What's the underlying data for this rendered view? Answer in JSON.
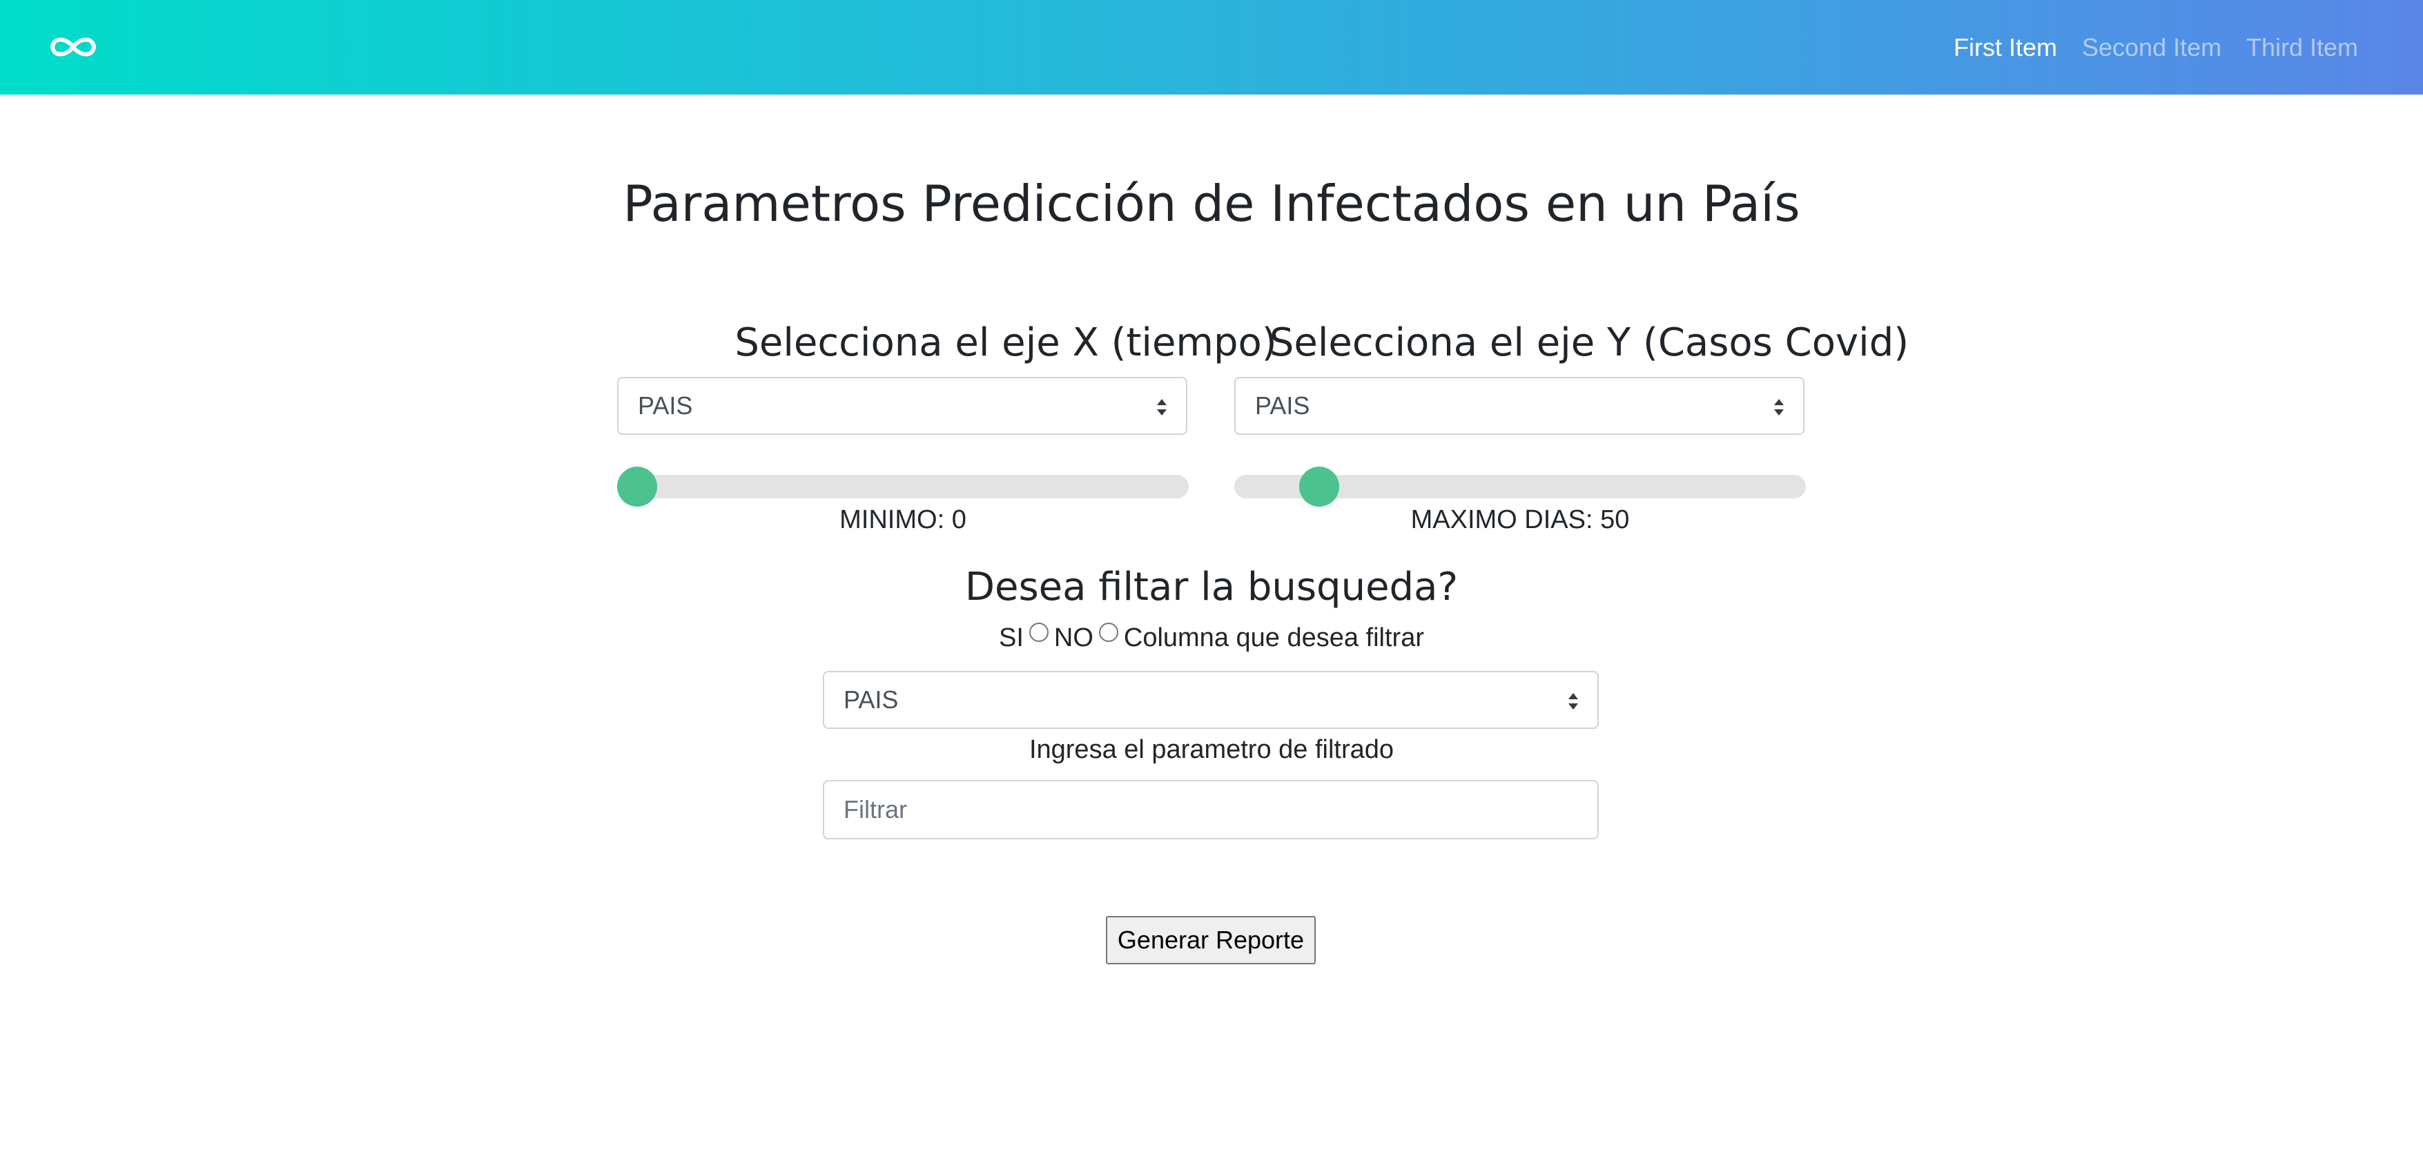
{
  "navbar": {
    "logo_icon": "infinity-icon",
    "items": [
      {
        "label": "First Item",
        "active": true
      },
      {
        "label": "Second Item",
        "active": false
      },
      {
        "label": "Third Item",
        "active": false
      }
    ],
    "gradient_colors": [
      "#00dcc9",
      "#5a86e8"
    ]
  },
  "page": {
    "title": "Parametros Predicción de Infectados en un País"
  },
  "axis_x": {
    "heading": "Selecciona el eje X (tiempo)",
    "select_value": "PAIS",
    "slider_value": 0,
    "caption": "MINIMO: 0"
  },
  "axis_y": {
    "heading": "Selecciona el eje Y (Casos Covid)",
    "select_value": "PAIS",
    "slider_value": 50,
    "caption": "MAXIMO DIAS: 50"
  },
  "filter": {
    "heading": "Desea filtar la busqueda?",
    "option_si": "SI",
    "option_no": "NO",
    "column_label": "Columna que desea filtrar",
    "column_select_value": "PAIS",
    "helper_label": "Ingresa el parametro de filtrado",
    "input_placeholder": "Filtrar"
  },
  "actions": {
    "generate_label": "Generar Reporte"
  },
  "colors": {
    "slider_thumb": "#4cc28f",
    "slider_track": "#e3e3e3"
  }
}
